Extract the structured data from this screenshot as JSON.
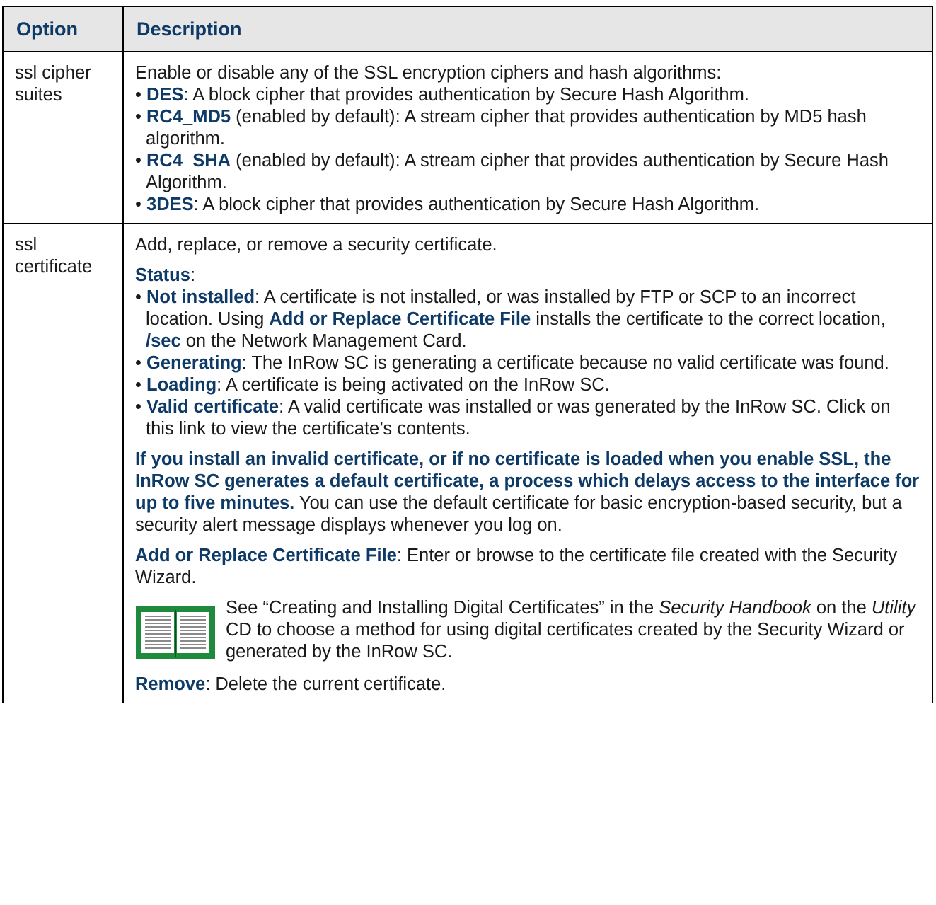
{
  "table": {
    "header": {
      "option": "Option",
      "description": "Description"
    },
    "row1": {
      "option": "ssl cipher suites",
      "intro": "Enable or disable any of the SSL encryption ciphers and hash algorithms:",
      "items": [
        {
          "term": "DES",
          "note": "",
          "text": ": A block cipher that provides authentication by Secure Hash Algorithm."
        },
        {
          "term": "RC4_MD5",
          "note": " (enabled by default)",
          "text": ": A stream cipher that provides authentication by MD5 hash algorithm."
        },
        {
          "term": "RC4_SHA",
          "note": " (enabled by default)",
          "text": ": A stream cipher that provides authentication by Secure Hash Algorithm."
        },
        {
          "term": "3DES",
          "note": "",
          "text": ": A block cipher that provides authentication by Secure Hash Algorithm."
        }
      ]
    },
    "row2": {
      "option": "ssl certificate",
      "intro": "Add, replace, or remove a security certificate.",
      "status_label": "Status",
      "status_colon": ":",
      "status_items": {
        "not_installed": {
          "term": "Not installed",
          "t1": ": A certificate is not installed, or was installed by FTP or SCP to an incorrect location. Using ",
          "link": "Add or Replace Certificate File",
          "t2": " installs the certificate to the correct location, ",
          "path": "/sec",
          "t3": " on the Network Management Card."
        },
        "generating": {
          "term": "Generating",
          "text": ": The InRow SC is generating a certificate because no valid certificate was found."
        },
        "loading": {
          "term": "Loading",
          "text": ": A certificate is being activated on the InRow SC."
        },
        "valid": {
          "term": "Valid certificate",
          "text": ": A valid certificate was installed or was generated by the InRow SC. Click on this link to view the certificate’s contents."
        }
      },
      "warning_bold": "If you install an invalid certificate, or if no certificate is loaded when you enable SSL, the InRow SC generates a default certificate, a process which delays access to the interface for up to five minutes.",
      "warning_rest": " You can use the default certificate for basic encryption-based security, but a security alert message displays whenever you log on.",
      "add_label": "Add or Replace Certificate File",
      "add_text": ": Enter or browse to the certificate file created with the Security Wizard.",
      "see": {
        "t1": "See “Creating and Installing Digital Certificates” in the ",
        "i1": "Security Handbook",
        "t2": " on the ",
        "i2": "Utility",
        "t3": " CD to choose a method for using digital certificates created by the Security Wizard or generated by the InRow SC."
      },
      "remove_label": "Remove",
      "remove_text": ": Delete the current certificate."
    }
  },
  "colors": {
    "accent": "#0d3a66",
    "header_bg": "#e6e6e6",
    "icon_green": "#1f8a3c"
  },
  "icons": {
    "note": "book-icon"
  }
}
